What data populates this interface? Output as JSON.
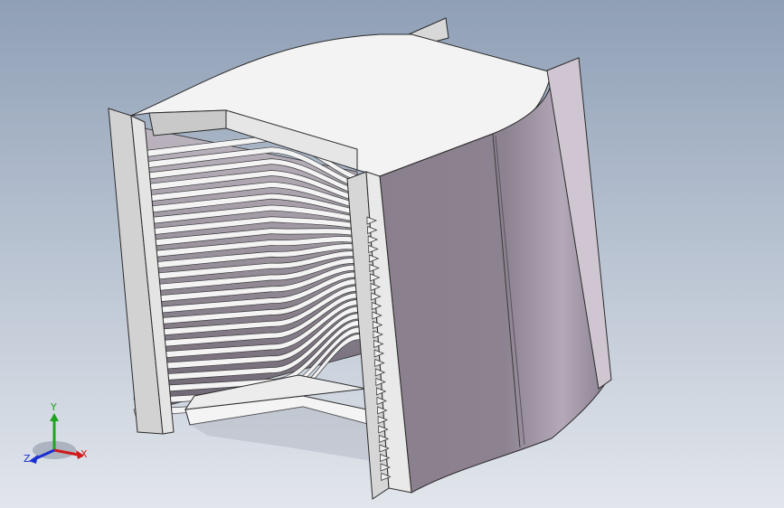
{
  "viewport": {
    "part": "slotted-sleeve-3d-model",
    "colors": {
      "top_face": "#f3f3f3",
      "curved_face": "#8d8290",
      "curved_highlight": "#b9aebd",
      "flange_face": "#cfcfcf",
      "edge": "#2a2a2a",
      "slot_face": "#f4f4f4"
    }
  },
  "triad": {
    "x_label": "X",
    "y_label": "Y",
    "z_label": "Z",
    "colors": {
      "x": "#d11a1a",
      "y": "#1ea51e",
      "z": "#1a2fd1"
    }
  }
}
